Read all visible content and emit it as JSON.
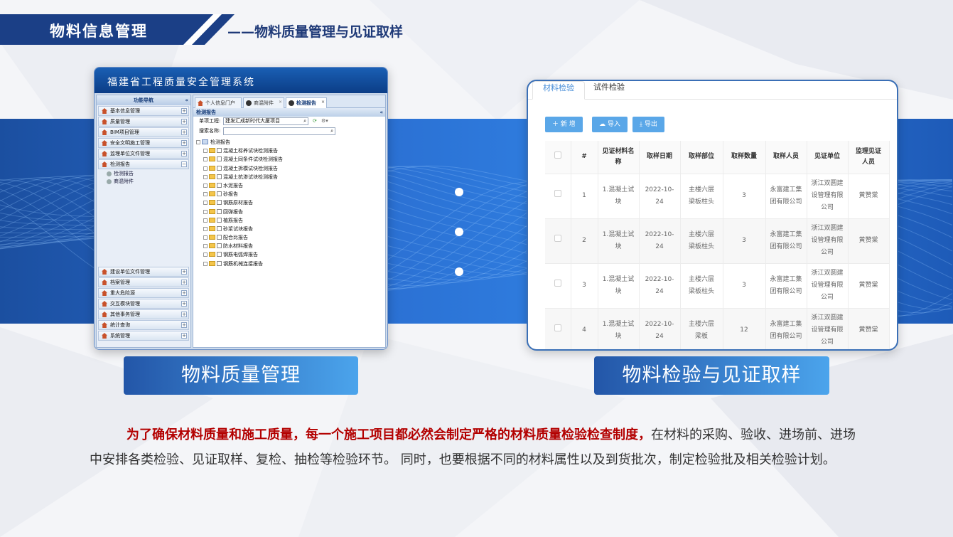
{
  "header": {
    "title": "物料信息管理",
    "subtitle": "——物料质量管理与见证取样"
  },
  "left_app": {
    "system_title": "福建省工程质量安全管理系统",
    "nav_title": "功能导航",
    "nav_top": [
      {
        "label": "基本信息管理",
        "sign": "+"
      },
      {
        "label": "质量管理",
        "sign": "+"
      },
      {
        "label": "BIM项目管理",
        "sign": "+"
      },
      {
        "label": "安全文明施工管理",
        "sign": "+"
      },
      {
        "label": "监理单位文件管理",
        "sign": "+"
      },
      {
        "label": "检测报告",
        "sign": "−"
      }
    ],
    "nav_sub": [
      "检测报告",
      "商混附件"
    ],
    "nav_bottom": [
      {
        "label": "建设单位文件管理",
        "sign": "+"
      },
      {
        "label": "档案管理",
        "sign": "+"
      },
      {
        "label": "重大危险源",
        "sign": "+"
      },
      {
        "label": "交互模块管理",
        "sign": "+"
      },
      {
        "label": "其他事务管理",
        "sign": "+"
      },
      {
        "label": "统计查询",
        "sign": "+"
      },
      {
        "label": "系统管理",
        "sign": "+"
      }
    ],
    "collapse_glyph": "«",
    "tabs": [
      {
        "label": "个人信息门户"
      },
      {
        "label": "商混附件",
        "close": "×"
      },
      {
        "label": "检测报告",
        "close": "×"
      }
    ],
    "panel_title": "检测报告",
    "filter": {
      "project_label": "单项工程:",
      "project_value": "建发汇成新时代大厦项目",
      "search_label": "搜索名称:"
    },
    "tree_root": "检测报告",
    "tree_items": [
      "混凝土标养试块检测报告",
      "混凝土同条件试块检测报告",
      "混凝土拆模试块检测报告",
      "混凝土抗渗试块检测报告",
      "水泥报告",
      "砂报告",
      "钢筋原材报告",
      "回弹报告",
      "植筋报告",
      "砂浆试块报告",
      "配合比报告",
      "防水材料报告",
      "钢筋电弧焊报告",
      "钢筋机械连接报告"
    ]
  },
  "right_app": {
    "tabs": [
      "材料检验",
      "试件检验"
    ],
    "buttons": {
      "add": "＋ 新 增",
      "import": "☁ 导入",
      "export": "⤓ 导出"
    },
    "columns": [
      "#",
      "见证材料名称",
      "取样日期",
      "取样部位",
      "取样数量",
      "取样人员",
      "见证单位",
      "监理见证人员"
    ],
    "rows": [
      {
        "no": "1",
        "material": "1.混凝土试块",
        "date": "2022-10-24",
        "part": "主楼六层梁板柱头",
        "qty": "3",
        "sampler": "永富建工集团有限公司",
        "unit": "浙江双圆建设管理有限公司",
        "supervisor": "黄赞棠"
      },
      {
        "no": "2",
        "material": "1.混凝土试块",
        "date": "2022-10-24",
        "part": "主楼六层梁板柱头",
        "qty": "3",
        "sampler": "永富建工集团有限公司",
        "unit": "浙江双圆建设管理有限公司",
        "supervisor": "黄赞棠"
      },
      {
        "no": "3",
        "material": "1.混凝土试块",
        "date": "2022-10-24",
        "part": "主楼六层梁板柱头",
        "qty": "3",
        "sampler": "永富建工集团有限公司",
        "unit": "浙江双圆建设管理有限公司",
        "supervisor": "黄赞棠"
      },
      {
        "no": "4",
        "material": "1.混凝土试块",
        "date": "2022-10-24",
        "part": "主楼六层梁板",
        "qty": "12",
        "sampler": "永富建工集团有限公司",
        "unit": "浙江双圆建设管理有限公司",
        "supervisor": "黄赞棠"
      }
    ]
  },
  "captions": {
    "left": "物料质量管理",
    "right": "物料检验与见证取样"
  },
  "paragraph": {
    "emphasis": "为了确保材料质量和施工质量，每一个施工项目都必然会制定严格的材料质量检验检查制度，",
    "rest": "在材料的采购、验收、进场前、进场中安排各类检验、见证取样、复检、抽检等检验环节。 同时，也要根据不同的材料属性以及到货批次，制定检验批及相关检验计划。"
  },
  "colors": {
    "brand_blue": "#1b4fa0",
    "accent": "#4ba4ec",
    "emphasis_red": "#b30000"
  }
}
